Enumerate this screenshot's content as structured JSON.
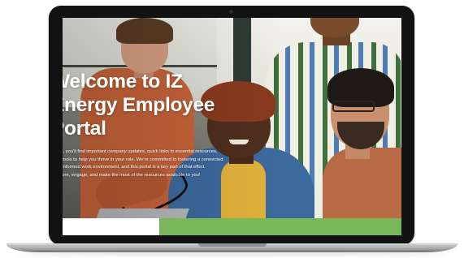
{
  "hero": {
    "title_lines": [
      "Welcome to IZ",
      "Energy Employee",
      "Portal"
    ],
    "description": "Here, you'll find important company updates, quick links to essential resources, and tools to help you thrive in your role. We're committed to fostering a connected and informed work environment, and this portal is a key part of that effort. Explore, engage, and make the most of the resources available to you!"
  },
  "photo": {
    "description_icon": "team-photo"
  },
  "colors": {
    "accent_green": "#79b85a",
    "bezel": "#121212",
    "text": "#ffffff"
  }
}
